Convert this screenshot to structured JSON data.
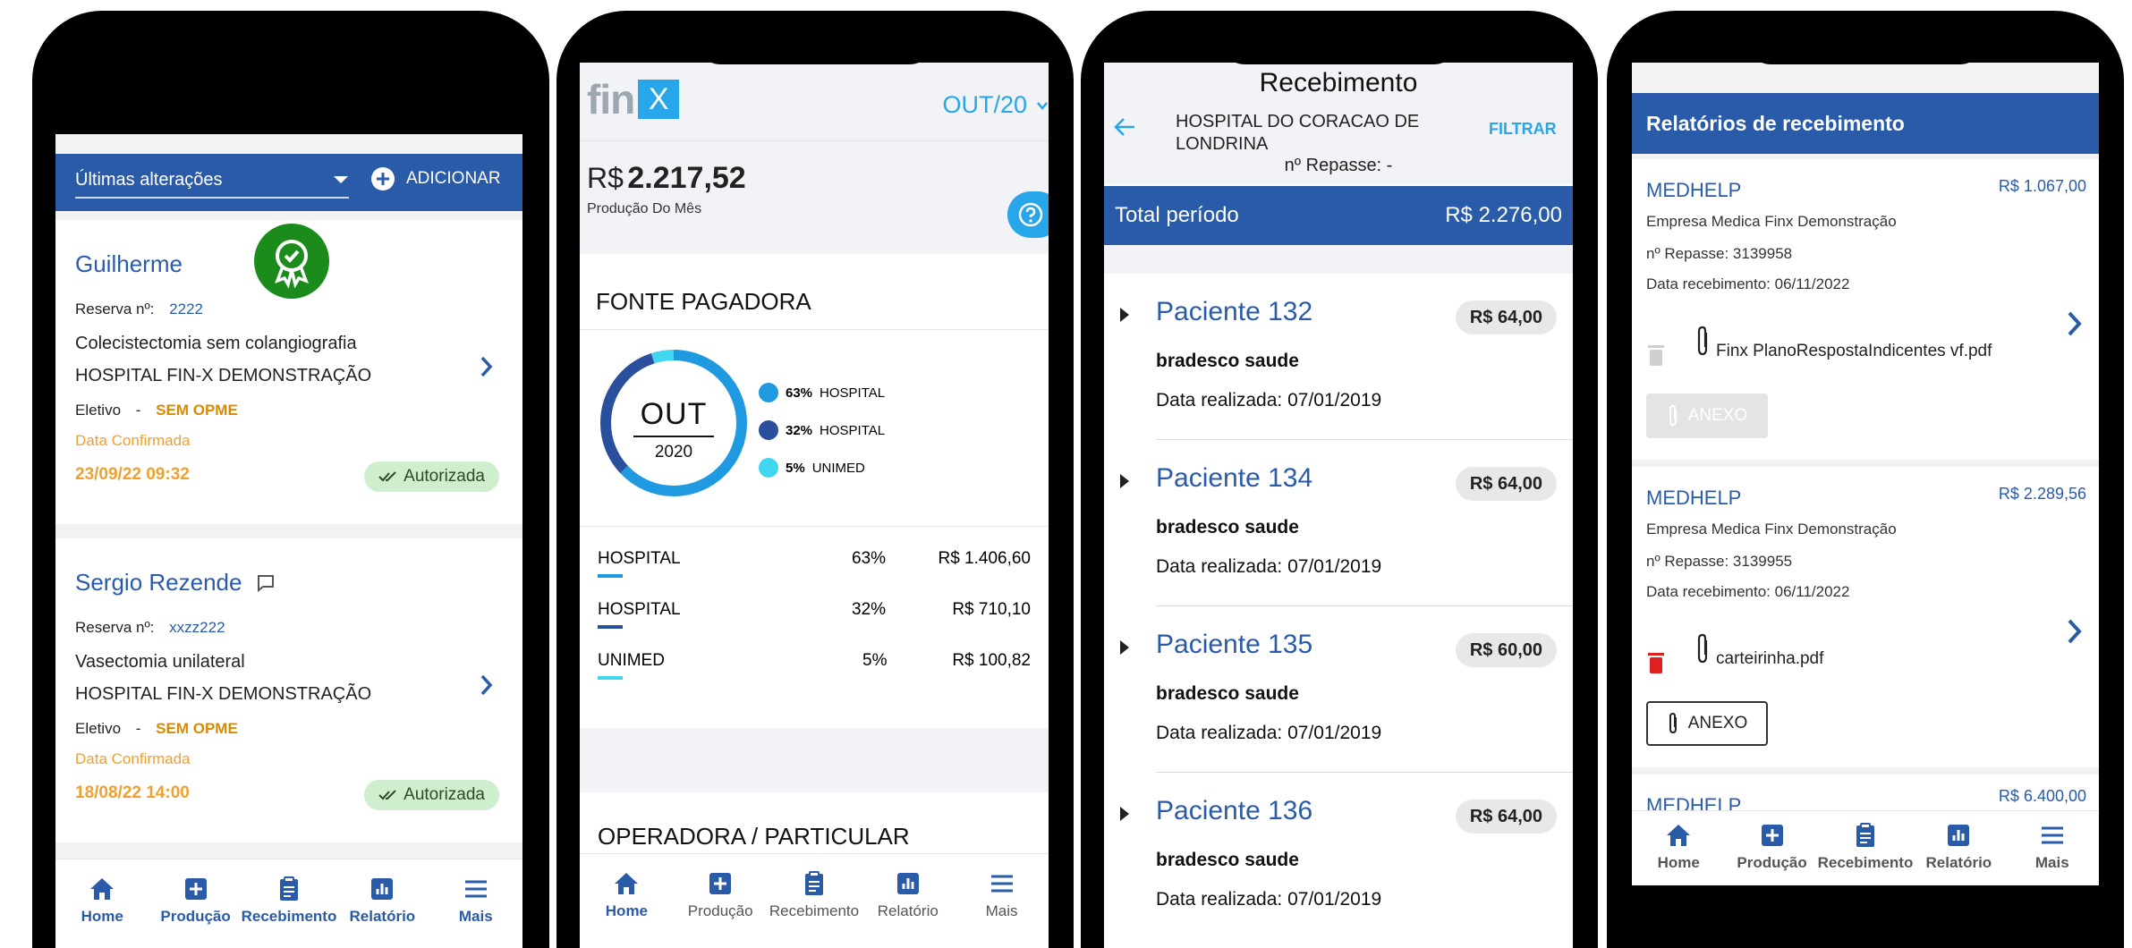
{
  "nav": {
    "home": "Home",
    "producao": "Produção",
    "recebimento": "Recebimento",
    "relatorio": "Relatório",
    "mais": "Mais"
  },
  "phone1": {
    "filter_label": "Últimas alterações",
    "add_label": "ADICIONAR",
    "cards": [
      {
        "name": "Guilherme",
        "reserva_label": "Reserva nº:",
        "reserva": "2222",
        "procedure": "Colecistectomia sem colangiografia",
        "hospital": "HOSPITAL FIN-X DEMONSTRAÇÃO",
        "tipo": "Eletivo",
        "sep": "-",
        "opme": "SEM OPME",
        "confirm": "Data Confirmada",
        "date": "23/09/22 09:32",
        "status": "Autorizada"
      },
      {
        "name": "Sergio Rezende",
        "reserva_label": "Reserva nº:",
        "reserva": "xxzz222",
        "procedure": "Vasectomia unilateral",
        "hospital": "HOSPITAL FIN-X DEMONSTRAÇÃO",
        "tipo": "Eletivo",
        "sep": "-",
        "opme": "SEM OPME",
        "confirm": "Data Confirmada",
        "date": "18/08/22 14:00",
        "status": "Autorizada"
      }
    ]
  },
  "phone2": {
    "logo_left": "fin",
    "logo_right": "X",
    "month": "OUT/20",
    "currency": "R$",
    "amount": "2.217,52",
    "amount_caption": "Produção Do Mês",
    "section1": "FONTE PAGADORA",
    "donut_month": "OUT",
    "donut_year": "2020",
    "legend": [
      {
        "pct": "63%",
        "label": "HOSPITAL",
        "color": "#1f9ae0"
      },
      {
        "pct": "32%",
        "label": "HOSPITAL",
        "color": "#2a4f9c"
      },
      {
        "pct": "5%",
        "label": "UNIMED",
        "color": "#41d6ef"
      }
    ],
    "rows": [
      {
        "name": "HOSPITAL",
        "pct": "63%",
        "value": "R$ 1.406,60",
        "color": "#1f9ae0"
      },
      {
        "name": "HOSPITAL",
        "pct": "32%",
        "value": "R$ 710,10",
        "color": "#2a4f9c"
      },
      {
        "name": "UNIMED",
        "pct": "5%",
        "value": "R$ 100,82",
        "color": "#41d6ef"
      }
    ],
    "donut_shares": [
      0.63,
      0.32,
      0.05
    ],
    "section2": "OPERADORA / PARTICULAR"
  },
  "phone3": {
    "title": "Recebimento",
    "hospital": "HOSPITAL DO CORACAO DE LONDRINA",
    "filter": "FILTRAR",
    "repasse": "nº Repasse: -",
    "total_label": "Total período",
    "total_value": "R$ 2.276,00",
    "items": [
      {
        "name": "Paciente 132",
        "value": "R$ 64,00",
        "plan": "bradesco saude",
        "date": "Data realizada: 07/01/2019"
      },
      {
        "name": "Paciente 134",
        "value": "R$ 64,00",
        "plan": "bradesco saude",
        "date": "Data realizada: 07/01/2019"
      },
      {
        "name": "Paciente 135",
        "value": "R$ 60,00",
        "plan": "bradesco saude",
        "date": "Data realizada: 07/01/2019"
      },
      {
        "name": "Paciente 136",
        "value": "R$ 64,00",
        "plan": "bradesco saude",
        "date": "Data realizada: 07/01/2019"
      }
    ]
  },
  "phone4": {
    "header": "Relatórios de recebimento",
    "cards": [
      {
        "title": "MEDHELP",
        "value": "R$ 1.067,00",
        "company": "Empresa Medica Finx Demonstração",
        "repasse": "nº Repasse: 3139958",
        "date": "Data recebimento: 06/11/2022",
        "file": "Finx PlanoRespostaIndicentes vf.pdf",
        "anexo": "ANEXO"
      },
      {
        "title": "MEDHELP",
        "value": "R$ 2.289,56",
        "company": "Empresa Medica Finx Demonstração",
        "repasse": "nº Repasse: 3139955",
        "date": "Data recebimento: 06/11/2022",
        "file": "carteirinha.pdf",
        "anexo": "ANEXO"
      },
      {
        "title": "MEDHELP",
        "value": "R$ 6.400,00"
      }
    ]
  }
}
